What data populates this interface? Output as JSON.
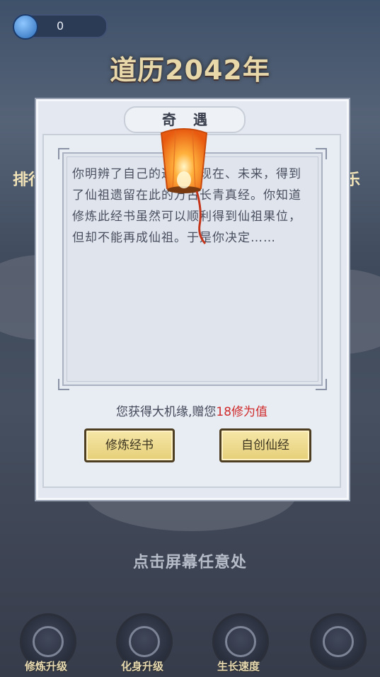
{
  "top_bar": {
    "coin_value": "0"
  },
  "header": {
    "year_title": "道历2042年"
  },
  "side": {
    "left_label": "排行",
    "right_label": "乐"
  },
  "modal": {
    "title": "奇遇",
    "story": "你明辨了自己的过去、现在、未来，得到了仙祖遗留在此的万古长青真经。你知道修炼此经书虽然可以顺利得到仙祖果位，但却不能再成仙祖。于是你决定……",
    "reward_prefix": "您获得大机缘,赠您",
    "reward_amount": "18修为值",
    "buttons": {
      "left": "修炼经书",
      "right": "自创仙经"
    }
  },
  "hint": "点击屏幕任意处",
  "bottom_nav": [
    {
      "label": "修炼升级",
      "icon": "taiji-icon"
    },
    {
      "label": "化身升级",
      "icon": "meditation-icon"
    },
    {
      "label": "生长速度",
      "icon": "swirl-icon"
    },
    {
      "label": "",
      "icon": "mountain-icon"
    }
  ],
  "colors": {
    "reward_highlight": "#d02b2b",
    "button_fill": "#f0dc8c",
    "title_gold": "#e7d7a9"
  }
}
